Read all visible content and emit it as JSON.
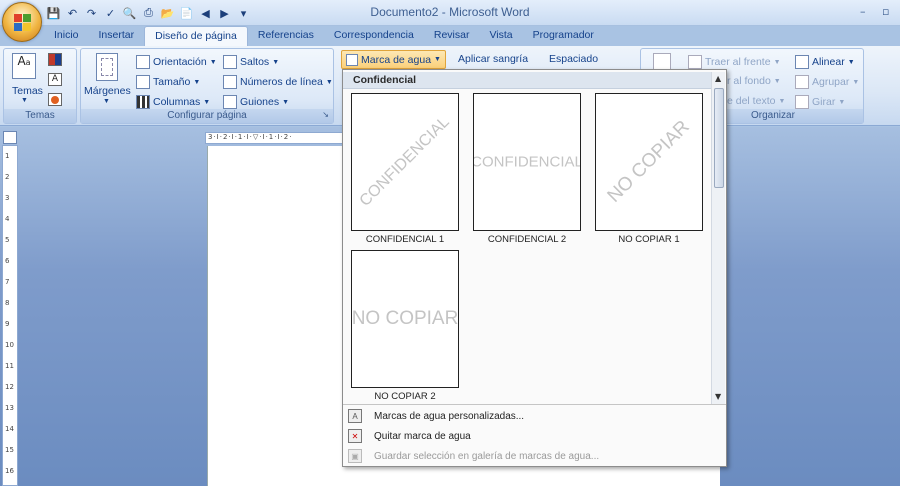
{
  "window": {
    "title": "Documento2 - Microsoft Word",
    "minimize": "–",
    "restore": "▫"
  },
  "tabs": [
    {
      "label": "Inicio"
    },
    {
      "label": "Insertar"
    },
    {
      "label": "Diseño de página",
      "active": true
    },
    {
      "label": "Referencias"
    },
    {
      "label": "Correspondencia"
    },
    {
      "label": "Revisar"
    },
    {
      "label": "Vista"
    },
    {
      "label": "Programador"
    }
  ],
  "ribbon": {
    "temas": {
      "label": "Temas",
      "group_label": "Temas"
    },
    "configurar_pagina": {
      "margenes": "Márgenes",
      "orientacion": "Orientación",
      "tamano": "Tamaño",
      "columnas": "Columnas",
      "saltos": "Saltos",
      "numeros_linea": "Números de línea",
      "guiones": "Guiones",
      "group_label": "Configurar página"
    },
    "fondo": {
      "marca_agua": "Marca de agua",
      "aplicar_sangria": "Aplicar sangría",
      "espaciado": "Espaciado"
    },
    "organizar": {
      "traer_frente": "Traer al frente",
      "enviar_fondo": "r al fondo",
      "ajustar_texto": "e del texto",
      "alinear": "Alinear",
      "agrupar": "Agrupar",
      "girar": "Girar",
      "group_label": "Organizar"
    }
  },
  "watermark_gallery": {
    "header": "Confidencial",
    "items": [
      {
        "label": "CONFIDENCIAL 1",
        "text": "CONFIDENCIAL",
        "orientation": "diagonal"
      },
      {
        "label": "CONFIDENCIAL 2",
        "text": "CONFIDENCIAL",
        "orientation": "horizontal"
      },
      {
        "label": "NO COPIAR 1",
        "text": "NO COPIAR",
        "orientation": "diagonal"
      },
      {
        "label": "NO COPIAR 2",
        "text": "NO COPIAR",
        "orientation": "horizontal"
      }
    ],
    "menu": [
      {
        "label": "Marcas de agua personalizadas...",
        "enabled": true
      },
      {
        "label": "Quitar marca de agua",
        "enabled": true
      },
      {
        "label": "Guardar selección en galería de marcas de agua...",
        "enabled": false
      }
    ]
  },
  "ruler": {
    "horizontal": "3·I·2·I·1·I·",
    "horizontal_right": "·I·1·I·2·",
    "vertical": [
      "1",
      "2",
      "3",
      "4",
      "5",
      "6",
      "7",
      "8",
      "9",
      "10",
      "11",
      "12",
      "13",
      "14",
      "15",
      "16"
    ]
  }
}
